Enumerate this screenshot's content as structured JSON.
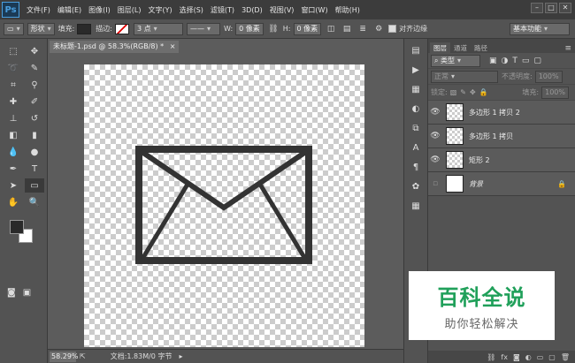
{
  "app": {
    "logo": "Ps"
  },
  "menu": [
    "文件(F)",
    "编辑(E)",
    "图像(I)",
    "图层(L)",
    "文字(Y)",
    "选择(S)",
    "滤镜(T)",
    "3D(D)",
    "视图(V)",
    "窗口(W)",
    "帮助(H)"
  ],
  "options": {
    "tool_mode": "形状",
    "fill_label": "填充:",
    "stroke_label": "描边:",
    "stroke_width": "3 点",
    "w_label": "W:",
    "w_value": "0 像素",
    "h_label": "H:",
    "h_value": "0 像素",
    "align_edges": "对齐边缘",
    "workspace": "基本功能"
  },
  "document": {
    "tab_title": "未标题-1.psd @ 58.3%(RGB/8) *",
    "close": "×",
    "zoom": "58.29%",
    "doc_info": "文档:1.83M/0 字节"
  },
  "panel": {
    "tabs": [
      "图层",
      "通道",
      "路径"
    ],
    "kind_filter": "类型",
    "blend_mode": "正常",
    "opacity_label": "不透明度:",
    "opacity_value": "100%",
    "lock_label": "锁定:",
    "fill_label": "填充:",
    "fill_value": "100%"
  },
  "layers": [
    {
      "name": "多边形 1 拷贝 2",
      "visible": true
    },
    {
      "name": "多边形 1 拷贝",
      "visible": true
    },
    {
      "name": "矩形 2",
      "visible": true
    },
    {
      "name": "背景",
      "visible": false
    }
  ],
  "watermark": {
    "title": "百科全说",
    "subtitle": "助你轻松解决"
  },
  "colors": {
    "foreground": "#2a2a2a",
    "background": "#ffffff",
    "shape": "#333333",
    "accent": "#4a9ede"
  }
}
